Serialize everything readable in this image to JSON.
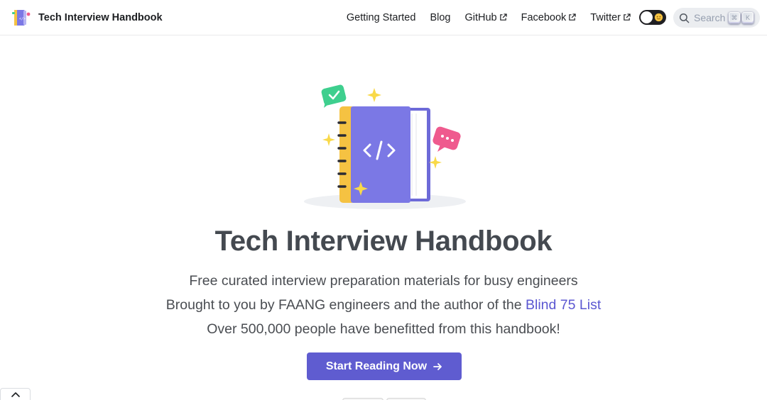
{
  "navbar": {
    "brand_title": "Tech Interview Handbook",
    "links": [
      {
        "label": "Getting Started",
        "external": false
      },
      {
        "label": "Blog",
        "external": false
      },
      {
        "label": "GitHub",
        "external": true
      },
      {
        "label": "Facebook",
        "external": true
      },
      {
        "label": "Twitter",
        "external": true
      }
    ],
    "theme_toggle_state": "light",
    "search": {
      "placeholder": "Search",
      "shortcut_keys": [
        "⌘",
        "K"
      ]
    }
  },
  "hero": {
    "title": "Tech Interview Handbook",
    "tagline_1": "Free curated interview preparation materials for busy engineers",
    "tagline_2_prefix": "Brought to you by FAANG engineers and the author of the ",
    "tagline_2_link": "Blind 75 List",
    "tagline_3": "Over 500,000 people have benefitted from this handbook!",
    "cta_label": "Start Reading Now"
  },
  "colors": {
    "accent": "#5f5cd0",
    "link": "#5b57d1",
    "title": "#444950",
    "book_cover": "#7b78e5",
    "book_spine": "#f5c242",
    "check_bubble": "#3ecf8e",
    "chat_bubble": "#ef5a8e",
    "sparkle": "#f9d949"
  },
  "icons": {
    "brand": "handbook-logo-icon",
    "external": "external-link-icon",
    "search": "search-icon",
    "theme": "sun-icon",
    "cta": "arrow-right-icon",
    "scroll_top": "chevron-up-icon"
  }
}
